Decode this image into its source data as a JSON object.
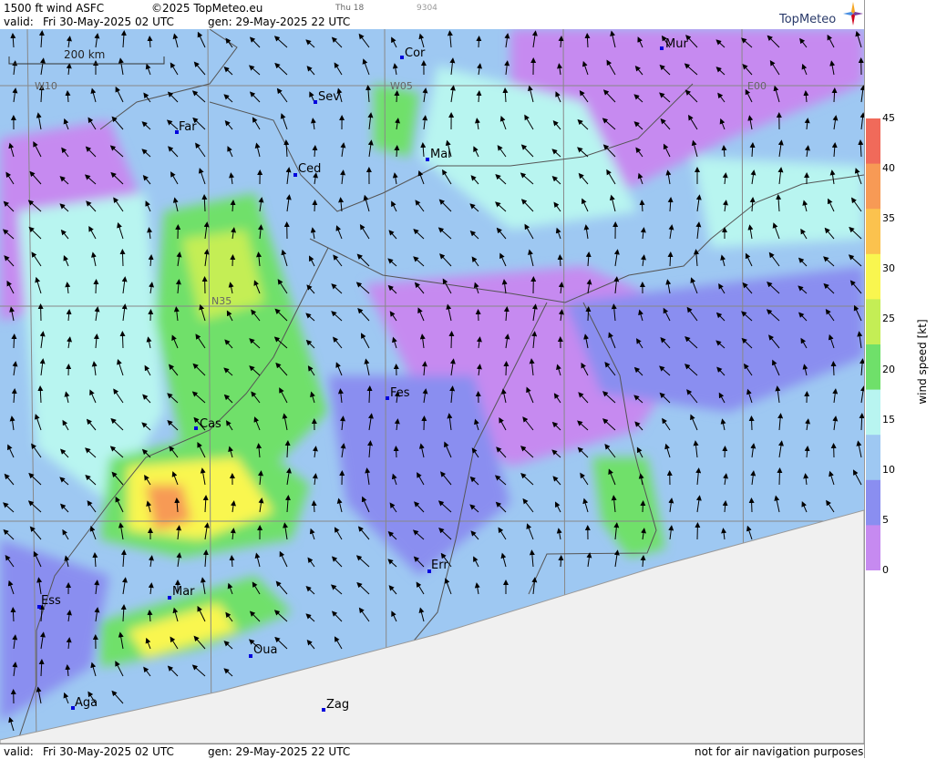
{
  "header": {
    "product": "1500 ft wind ASFC",
    "copyright": "©2025 TopMeteo.eu",
    "valid_label": "valid:",
    "valid_time": "Fri  30-May-2025  02 UTC",
    "gen": "gen: 29-May-2025 22 UTC",
    "small_day": "Thu 18",
    "small_code": "9304",
    "brand": "TopMeteo"
  },
  "footer": {
    "valid_label": "valid:",
    "valid_time": "Fri  30-May-2025  02 UTC",
    "gen": "gen: 29-May-2025 22 UTC",
    "disclaimer": "not for air navigation purposes"
  },
  "map": {
    "scale_label": "200 km",
    "grid_labels": [
      "W10",
      "W05",
      "E00",
      "N35"
    ],
    "cities": [
      {
        "name": "Cor"
      },
      {
        "name": "Mur"
      },
      {
        "name": "Sev"
      },
      {
        "name": "Far"
      },
      {
        "name": "Mal"
      },
      {
        "name": "Ced"
      },
      {
        "name": "Fes"
      },
      {
        "name": "Cas"
      },
      {
        "name": "Err"
      },
      {
        "name": "Ess"
      },
      {
        "name": "Mar"
      },
      {
        "name": "Oua"
      },
      {
        "name": "Aga"
      },
      {
        "name": "Zag"
      }
    ]
  },
  "legend": {
    "title": "wind speed [kt]",
    "ticks": [
      "45",
      "40",
      "35",
      "30",
      "25",
      "20",
      "15",
      "10",
      "5",
      "0"
    ],
    "colors": [
      "#f06a5a",
      "#f79a55",
      "#fbc24e",
      "#f9f64f",
      "#c4ee55",
      "#6fe06a",
      "#b8f5f0",
      "#9ec8f2",
      "#8a8ef0",
      "#c68af0"
    ]
  },
  "colors": {
    "nodata": "#f0f0f0",
    "grid": "#888888",
    "city": "#0000dd"
  }
}
